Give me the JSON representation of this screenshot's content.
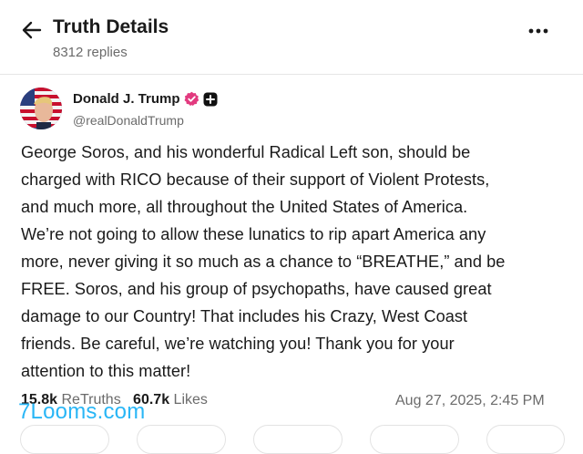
{
  "header": {
    "title": "Truth Details",
    "subtitle": "8312 replies",
    "back_icon": "arrow-left-icon",
    "more_icon": "more-horizontal-icon"
  },
  "author": {
    "name": "Donald J. Trump",
    "handle": "@realDonaldTrump",
    "verified_icon": "verified-badge-icon",
    "verified_color": "#e23a7f",
    "extra_icon": "plus-box-icon"
  },
  "post": {
    "lines": [
      "George Soros, and his wonderful Radical Left son, should be",
      "charged with RICO because of their support of Violent Protests,",
      "and much more, all throughout the United States of America.",
      "We’re not going to allow these lunatics to rip apart America any",
      "more, never giving it so much as a chance to “BREATHE,” and be",
      "FREE. Soros, and his group of psychopaths, have caused great",
      "damage to our Country! That includes his Crazy, West Coast",
      "friends. Be careful, we’re watching you! Thank you for your",
      "attention to this matter!"
    ]
  },
  "stats": {
    "retruths_count": "15.8k",
    "retruths_label": "ReTruths",
    "likes_count": "60.7k",
    "likes_label": "Likes",
    "timestamp": "Aug 27, 2025, 2:45 PM"
  },
  "watermark": "7Looms.com",
  "colors": {
    "text": "#1a1a1a",
    "muted": "#6b6b6b",
    "watermark": "#29b6f6"
  }
}
